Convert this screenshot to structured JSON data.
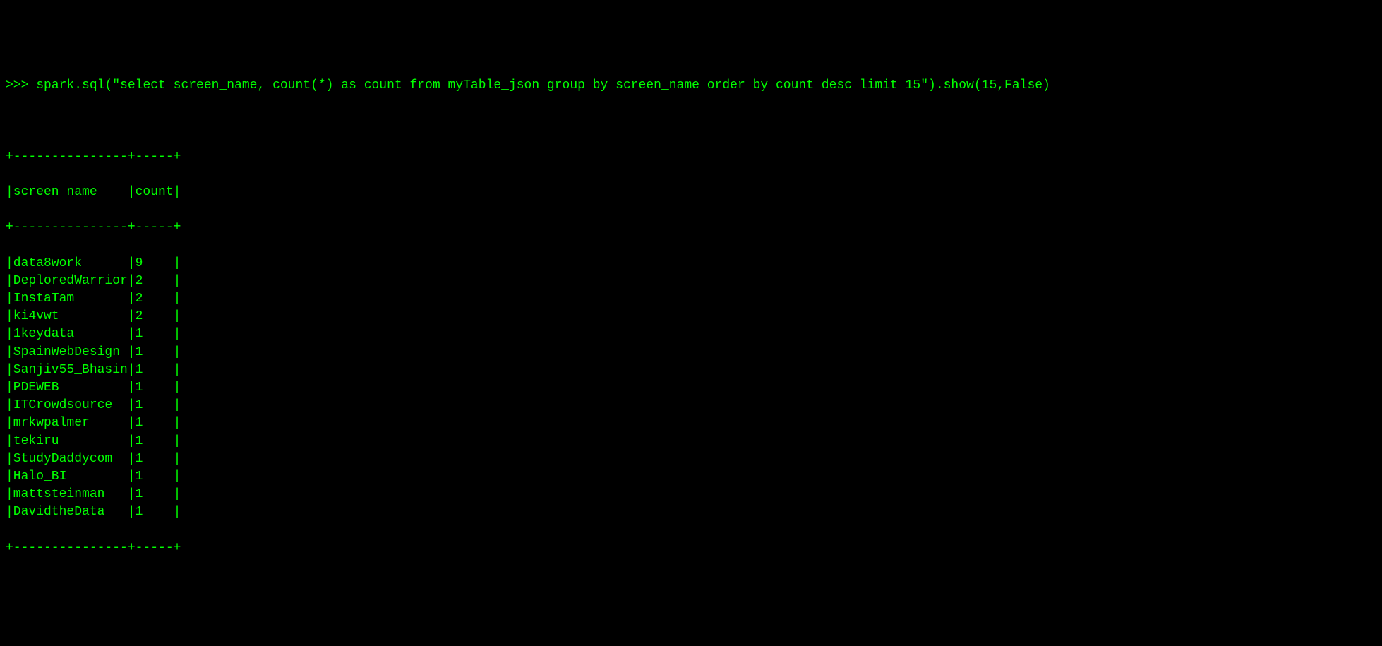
{
  "prompt": ">>> ",
  "command": "spark.sql(\"select screen_name, count(*) as count from myTable_json group by screen_name order by count desc limit 15\").show(15,False)",
  "chart_data": {
    "type": "table",
    "columns": [
      "screen_name",
      "count"
    ],
    "rows": [
      {
        "screen_name": "data8work",
        "count": 9
      },
      {
        "screen_name": "DeploredWarrior",
        "count": 2
      },
      {
        "screen_name": "InstaTam",
        "count": 2
      },
      {
        "screen_name": "ki4vwt",
        "count": 2
      },
      {
        "screen_name": "1keydata",
        "count": 1
      },
      {
        "screen_name": "SpainWebDesign",
        "count": 1
      },
      {
        "screen_name": "Sanjiv55_Bhasin",
        "count": 1
      },
      {
        "screen_name": "PDEWEB",
        "count": 1
      },
      {
        "screen_name": "ITCrowdsource",
        "count": 1
      },
      {
        "screen_name": "mrkwpalmer",
        "count": 1
      },
      {
        "screen_name": "tekiru",
        "count": 1
      },
      {
        "screen_name": "StudyDaddycom",
        "count": 1
      },
      {
        "screen_name": "Halo_BI",
        "count": 1
      },
      {
        "screen_name": "mattsteinman",
        "count": 1
      },
      {
        "screen_name": "DavidtheData",
        "count": 1
      }
    ]
  },
  "table_layout": {
    "col1_width": 15,
    "col2_width": 5,
    "border_top": "+---------------+-----+",
    "header_line": "|screen_name    |count|",
    "border_mid": "+---------------+-----+",
    "border_bot": "+---------------+-----+"
  }
}
